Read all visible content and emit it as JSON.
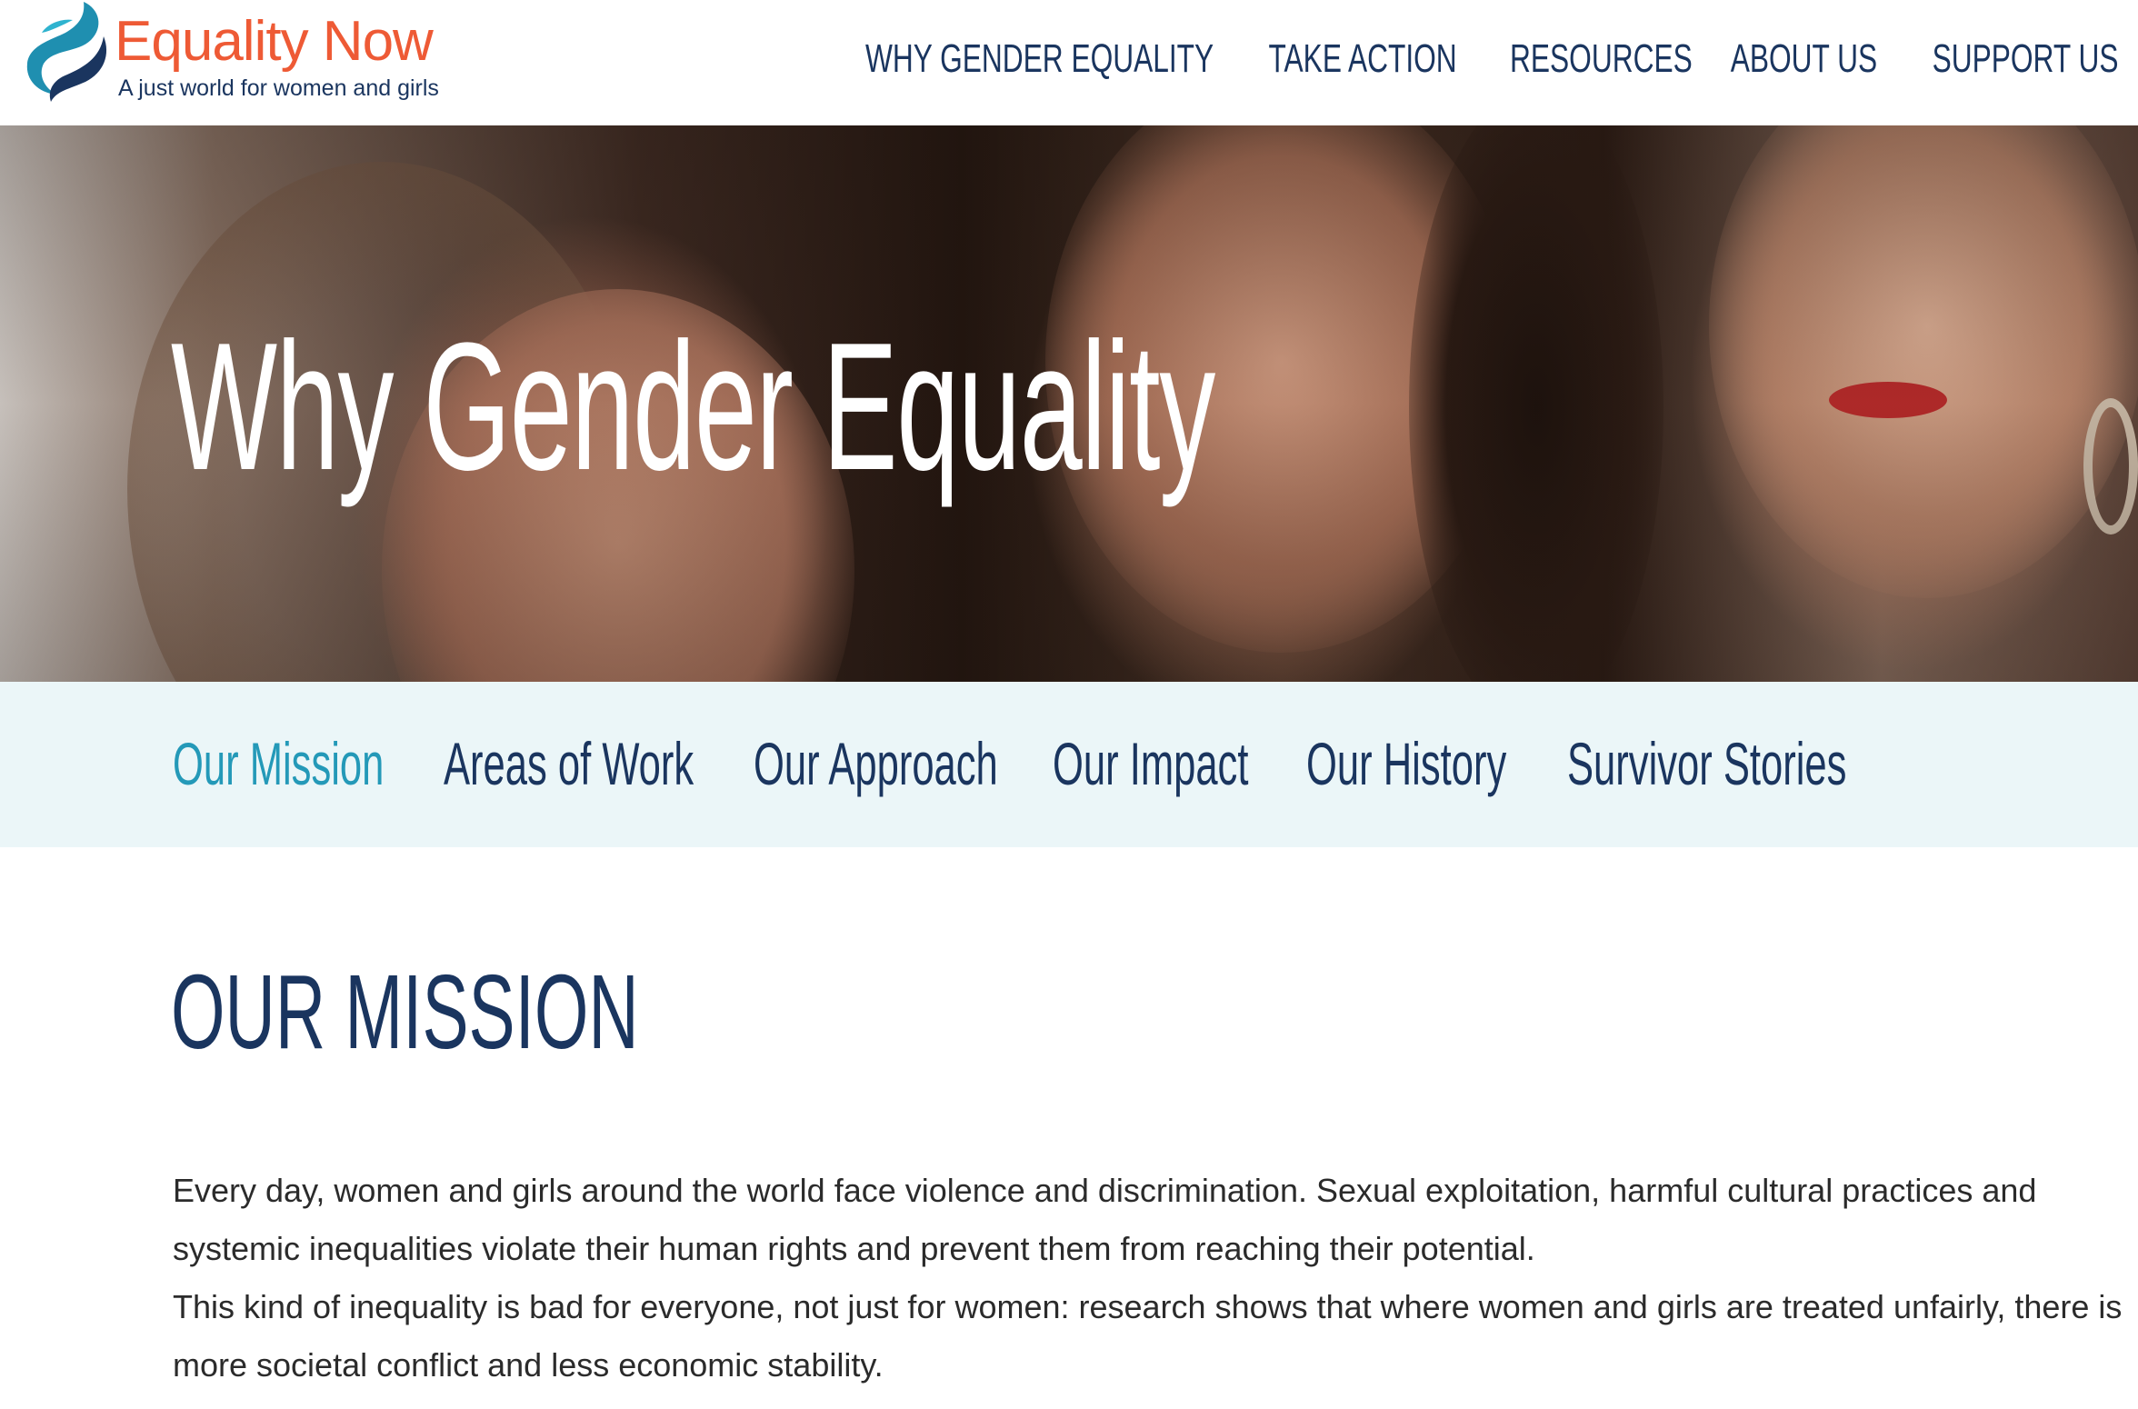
{
  "header": {
    "logo_name": "Equality Now",
    "logo_tagline": "A just world for women and girls",
    "nav": [
      {
        "label": "WHY GENDER EQUALITY"
      },
      {
        "label": "TAKE ACTION"
      },
      {
        "label": "RESOURCES"
      },
      {
        "label": "ABOUT US"
      },
      {
        "label": "SUPPORT US"
      }
    ],
    "colors": {
      "brand_orange": "#ee5a35",
      "brand_navy": "#1a355f",
      "brand_teal": "#2499b8"
    }
  },
  "hero": {
    "title": "Why Gender Equality"
  },
  "sub_nav": {
    "items": [
      {
        "label": "Our Mission",
        "active": true
      },
      {
        "label": "Areas of Work",
        "active": false
      },
      {
        "label": "Our Approach",
        "active": false
      },
      {
        "label": "Our Impact",
        "active": false
      },
      {
        "label": "Our History",
        "active": false
      },
      {
        "label": "Survivor Stories",
        "active": false
      }
    ]
  },
  "mission": {
    "heading": "OUR MISSION",
    "paragraphs": [
      "Every day, women and girls around the world face violence and discrimination. Sexual exploitation, harmful cultural practices and systemic inequalities violate their human rights and prevent them from reaching their potential.",
      "This kind of inequality is bad for everyone, not just for women: research shows that where women and girls are treated unfairly, there is more societal conflict and less economic stability."
    ]
  }
}
